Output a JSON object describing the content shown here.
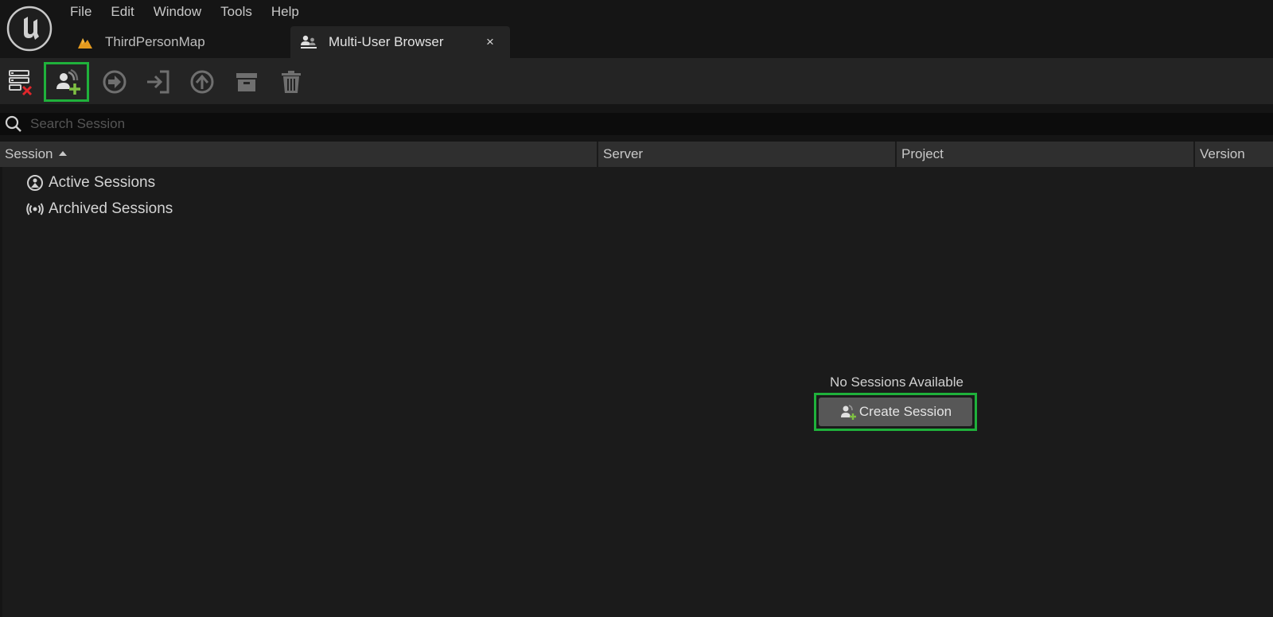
{
  "menu": {
    "items": [
      "File",
      "Edit",
      "Window",
      "Tools",
      "Help"
    ]
  },
  "tabs": [
    {
      "label": "ThirdPersonMap",
      "icon": "level-icon",
      "active": false
    },
    {
      "label": "Multi-User Browser",
      "icon": "multi-user-icon",
      "active": true,
      "close": "×"
    }
  ],
  "toolbar": {
    "buttons": [
      {
        "name": "server-settings-button",
        "icon": "server-error-icon"
      },
      {
        "name": "create-session-toolbar-button",
        "icon": "add-user-icon",
        "highlighted": true
      },
      {
        "name": "join-session-button",
        "icon": "join-icon"
      },
      {
        "name": "login-button",
        "icon": "enter-icon"
      },
      {
        "name": "upload-button",
        "icon": "upload-icon"
      },
      {
        "name": "archive-button",
        "icon": "archive-icon"
      },
      {
        "name": "delete-button",
        "icon": "trash-icon"
      }
    ]
  },
  "search": {
    "placeholder": "Search Session",
    "value": ""
  },
  "table": {
    "columns": [
      "Session",
      "Server",
      "Project",
      "Version"
    ],
    "sort_column": "Session",
    "groups": [
      {
        "label": "Active Sessions",
        "icon": "active-sessions-icon"
      },
      {
        "label": "Archived Sessions",
        "icon": "archived-sessions-icon"
      }
    ]
  },
  "empty_state": {
    "message": "No Sessions Available",
    "button_label": "Create Session"
  },
  "colors": {
    "highlight": "#1fb13b",
    "accent_orange": "#e59a1e",
    "add_green": "#7fc043",
    "delete_red": "#e0262b"
  }
}
